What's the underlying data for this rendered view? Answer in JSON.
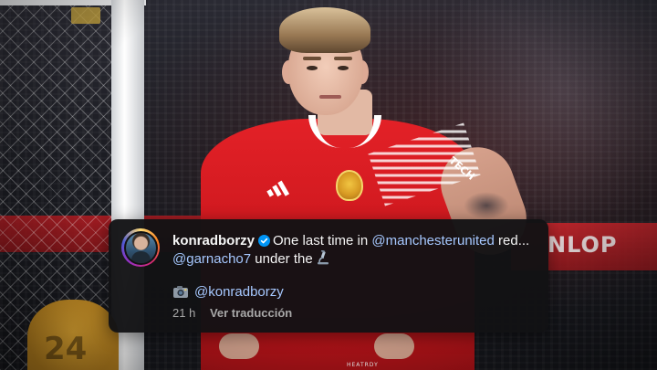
{
  "photo": {
    "board_text": "NLOP",
    "keeper_number": "24",
    "sleeve_text": "TECH",
    "shorts_text": "HEATRDY"
  },
  "comment": {
    "username": "konradborzy",
    "verified": true,
    "text_part1": "One last time in",
    "mention1": "@manchesterunited",
    "text_part2": "red...",
    "mention2": "@garnacho7",
    "text_part3": "under the",
    "emoji_after": "microscope-icon",
    "credit_icon": "camera-icon",
    "credit_mention": "@konradborzy",
    "time": "21 h",
    "translate_label": "Ver traducción"
  },
  "colors": {
    "card_bg": "#121214",
    "mention": "#a6c8ff",
    "verified": "#0095f6",
    "kit_red": "#e32127"
  }
}
